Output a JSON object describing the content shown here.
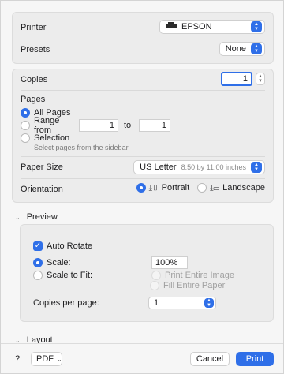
{
  "printer": {
    "label": "Printer",
    "value": "EPSON",
    "icon": "printer-icon"
  },
  "presets": {
    "label": "Presets",
    "value": "None"
  },
  "copies": {
    "label": "Copies",
    "value": "1"
  },
  "pages": {
    "label": "Pages",
    "all_pages": "All Pages",
    "range_from": "Range from",
    "range_from_value": "1",
    "to": "to",
    "range_to_value": "1",
    "selection": "Selection",
    "selection_hint": "Select pages from the sidebar"
  },
  "paper_size": {
    "label": "Paper Size",
    "value": "US Letter",
    "dimensions": "8.50 by 11.00 inches"
  },
  "orientation": {
    "label": "Orientation",
    "portrait": "Portrait",
    "landscape": "Landscape"
  },
  "preview": {
    "title": "Preview",
    "auto_rotate": "Auto Rotate",
    "scale": "Scale:",
    "scale_value": "100%",
    "scale_to_fit": "Scale to Fit:",
    "print_entire_image": "Print Entire Image",
    "fill_entire_paper": "Fill Entire Paper",
    "copies_per_page": "Copies per page:",
    "copies_per_page_value": "1"
  },
  "layout": {
    "title": "Layout"
  },
  "footer": {
    "help": "?",
    "pdf": "PDF",
    "cancel": "Cancel",
    "print": "Print"
  },
  "colors": {
    "accent": "#2f6fe8"
  }
}
